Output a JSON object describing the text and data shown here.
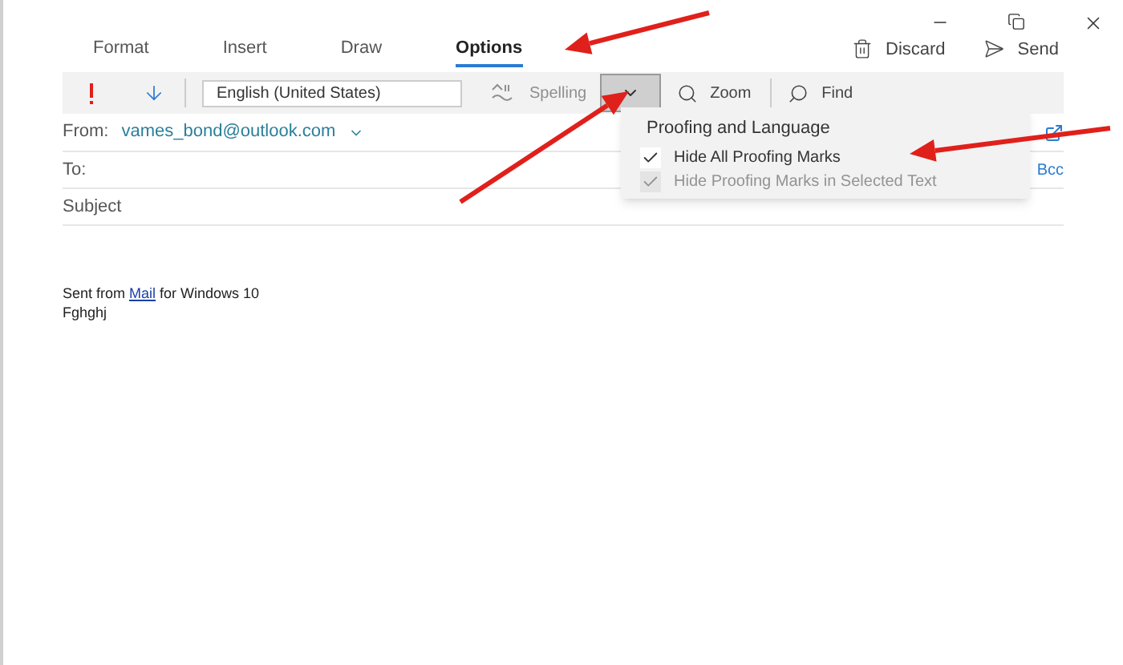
{
  "tabs": [
    {
      "label": "Format",
      "selected": false
    },
    {
      "label": "Insert",
      "selected": false
    },
    {
      "label": "Draw",
      "selected": false
    },
    {
      "label": "Options",
      "selected": true
    }
  ],
  "actions": [
    {
      "kind": "discard",
      "label": "Discard"
    },
    {
      "kind": "send",
      "label": "Send"
    }
  ],
  "toolbar": {
    "language": "English (United States)",
    "spelling": {
      "label": "Spelling",
      "disabled": true
    },
    "dropdown_pressed": true,
    "zoom": "Zoom",
    "find": "Find"
  },
  "from": {
    "label": "From:",
    "value": "vames_bond@outlook.com"
  },
  "to": {
    "label": "To:",
    "bcc": "Bcc"
  },
  "subject": {
    "placeholder": "Subject"
  },
  "menu": {
    "heading": "Proofing and Language",
    "items": [
      {
        "label": "Hide All Proofing Marks",
        "checked": true,
        "disabled": false
      },
      {
        "label": "Hide Proofing Marks in Selected Text",
        "checked": true,
        "disabled": true
      }
    ]
  },
  "body": {
    "signature": {
      "before": "Sent from ",
      "link": "Mail",
      "after": " for Windows 10"
    },
    "text": "Fghghj"
  }
}
